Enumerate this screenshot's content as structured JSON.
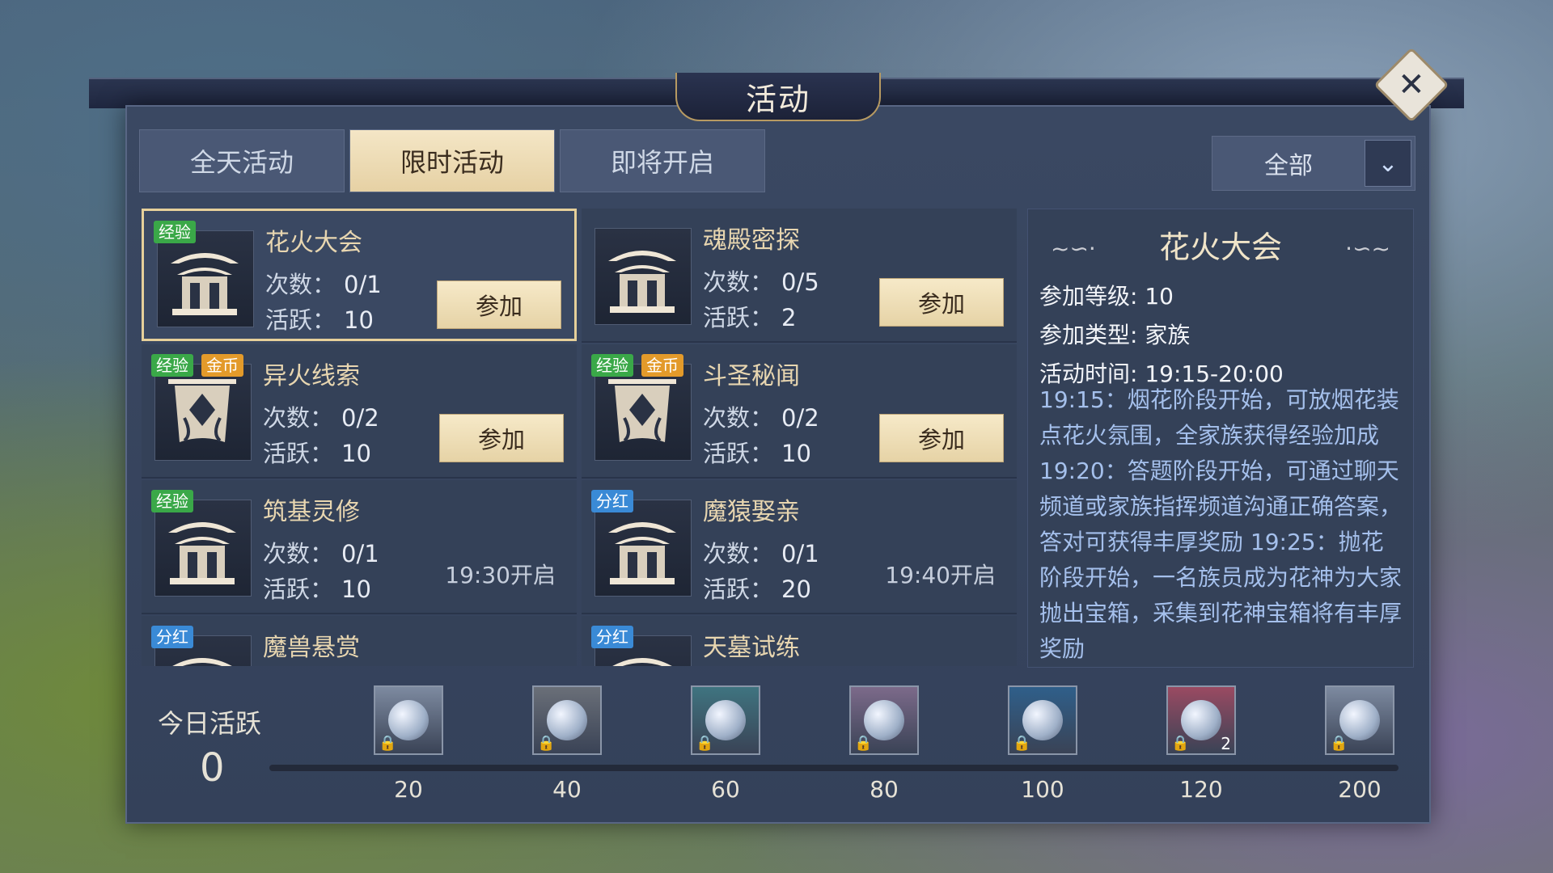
{
  "window": {
    "title": "活动"
  },
  "tabs": [
    {
      "label": "全天活动",
      "active": false
    },
    {
      "label": "限时活动",
      "active": true
    },
    {
      "label": "即将开启",
      "active": false
    }
  ],
  "filter": {
    "label": "全部"
  },
  "fields": {
    "count": "次数：",
    "activity": "活跃："
  },
  "activities": [
    {
      "title": "花火大会",
      "tags": [
        "经验"
      ],
      "count": "0/1",
      "active": "10",
      "button": "参加",
      "selected": true,
      "icon": "pavilion-icon"
    },
    {
      "title": "魂殿密探",
      "tags": [],
      "count": "0/5",
      "active": "2",
      "button": "参加",
      "icon": "pavilion-icon"
    },
    {
      "title": "异火线索",
      "tags": [
        "经验",
        "金币"
      ],
      "count": "0/2",
      "active": "10",
      "button": "参加",
      "icon": "banner-icon"
    },
    {
      "title": "斗圣秘闻",
      "tags": [
        "经验",
        "金币"
      ],
      "count": "0/2",
      "active": "10",
      "button": "参加",
      "icon": "banner-icon"
    },
    {
      "title": "筑基灵修",
      "tags": [
        "经验"
      ],
      "count": "0/1",
      "active": "10",
      "time": "19:30开启",
      "icon": "pavilion-icon"
    },
    {
      "title": "魔猿娶亲",
      "tags": [
        "分红"
      ],
      "count": "0/1",
      "active": "20",
      "time": "19:40开启",
      "icon": "pavilion-icon"
    },
    {
      "title": "魔兽悬赏",
      "tags": [
        "分红"
      ],
      "icon": "pavilion-icon"
    },
    {
      "title": "天墓试练",
      "tags": [
        "分红"
      ],
      "icon": "pavilion-icon"
    }
  ],
  "detail": {
    "title": "花火大会",
    "level_label": "参加等级: 10",
    "type_label": "参加类型: 家族",
    "time_label": "活动时间: 19:15-20:00",
    "description": "19:15：烟花阶段开始，可放烟花装点花火氛围，全家族获得经验加成 19:20：答题阶段开始，可通过聊天频道或家族指挥频道沟通正确答案，答对可获得丰厚奖励 19:25：抛花阶段开始，一名族员成为花神为大家抛出宝箱，采集到花神宝箱将有丰厚奖励"
  },
  "today": {
    "label": "今日活跃",
    "value": "0"
  },
  "rewards": [
    {
      "threshold": "20",
      "icon": "jade-ring-icon",
      "color": "#7d8aa0"
    },
    {
      "threshold": "40",
      "icon": "red-ore-icon",
      "color": "#6a6f78"
    },
    {
      "threshold": "60",
      "icon": "gourd-icon",
      "color": "#3f7480"
    },
    {
      "threshold": "80",
      "icon": "orb-icon",
      "color": "#7c6a8a"
    },
    {
      "threshold": "100",
      "icon": "blue-crystal-icon",
      "color": "#2f5f8a"
    },
    {
      "threshold": "120",
      "icon": "gold-ring-icon",
      "color": "#9a4a62",
      "count": "2"
    },
    {
      "threshold": "200",
      "icon": "jade-ring-icon",
      "color": "#7d8aa0"
    }
  ]
}
